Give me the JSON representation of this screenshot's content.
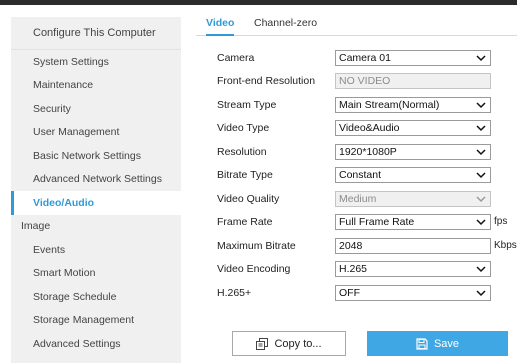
{
  "sidebar": {
    "header": "Configure This Computer",
    "items": [
      {
        "label": "System Settings"
      },
      {
        "label": "Maintenance"
      },
      {
        "label": "Security"
      },
      {
        "label": "User Management"
      },
      {
        "label": "Basic Network Settings"
      },
      {
        "label": "Advanced Network Settings"
      },
      {
        "label": "Video/Audio"
      },
      {
        "label": "Image"
      },
      {
        "label": "Events"
      },
      {
        "label": "Smart Motion"
      },
      {
        "label": "Storage Schedule"
      },
      {
        "label": "Storage Management"
      },
      {
        "label": "Advanced Settings"
      }
    ],
    "active": "Video/Audio"
  },
  "tabs": [
    {
      "label": "Video"
    },
    {
      "label": "Channel-zero"
    }
  ],
  "form": {
    "camera": {
      "label": "Camera",
      "value": "Camera 01"
    },
    "front_end_resolution": {
      "label": "Front-end Resolution",
      "value": "NO VIDEO"
    },
    "stream_type": {
      "label": "Stream Type",
      "value": "Main Stream(Normal)"
    },
    "video_type": {
      "label": "Video Type",
      "value": "Video&Audio"
    },
    "resolution": {
      "label": "Resolution",
      "value": "1920*1080P"
    },
    "bitrate_type": {
      "label": "Bitrate Type",
      "value": "Constant"
    },
    "video_quality": {
      "label": "Video Quality",
      "value": "Medium"
    },
    "frame_rate": {
      "label": "Frame Rate",
      "value": "Full Frame Rate",
      "unit": "fps"
    },
    "max_bitrate": {
      "label": "Maximum Bitrate",
      "value": "2048",
      "unit": "Kbps"
    },
    "video_encoding": {
      "label": "Video Encoding",
      "value": "H.265"
    },
    "h265plus": {
      "label": "H.265+",
      "value": "OFF"
    }
  },
  "buttons": {
    "copy": "Copy to...",
    "save": "Save"
  },
  "colors": {
    "accent": "#2f9ad6",
    "save_button": "#3fa7e3",
    "sidebar_bg": "#f0f0f0"
  }
}
